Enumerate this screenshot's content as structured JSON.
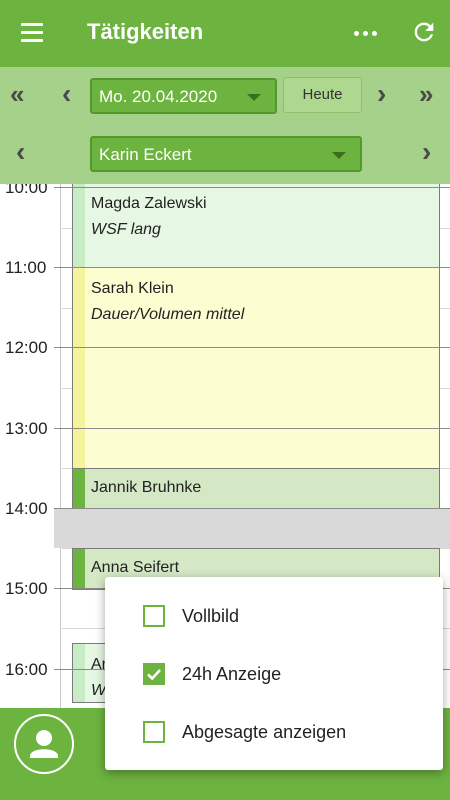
{
  "header": {
    "title": "Tätigkeiten",
    "icons": {
      "menu": "hamburger-menu-icon",
      "more": "more-dots-icon",
      "refresh": "refresh-icon"
    }
  },
  "date_nav": {
    "prev_week": "«",
    "prev_day": "‹",
    "date_value": "Mo. 20.04.2020",
    "today_label": "Heute",
    "next_day": "›",
    "next_week": "»"
  },
  "employee_nav": {
    "prev": "‹",
    "employee_value": "Karin Eckert",
    "next": "›"
  },
  "timeline": {
    "hours": [
      "10:00",
      "11:00",
      "12:00",
      "13:00",
      "14:00",
      "15:00",
      "16:00"
    ],
    "events": [
      {
        "name": "Magda Zalewski",
        "subtitle": "WSF lang",
        "color": "#e6f7e3",
        "stripe": "#c8ecc6"
      },
      {
        "name": "Sarah Klein",
        "subtitle": "Dauer/Volumen mittel",
        "color": "#fdfdd2",
        "stripe": "#f4f49c"
      },
      {
        "name": "Jannik Bruhnke",
        "subtitle": "",
        "color": "#d4e8c6",
        "stripe": "#6db33f"
      },
      {
        "name": "Anna Seifert",
        "subtitle": "",
        "color": "#d4e8c6",
        "stripe": "#6db33f"
      },
      {
        "name": "An",
        "subtitle": "W",
        "color": "#e6f7e3",
        "stripe": "#c8ecc6"
      }
    ]
  },
  "options_menu": {
    "items": [
      {
        "label": "Vollbild",
        "checked": false
      },
      {
        "label": "24h Anzeige",
        "checked": true
      },
      {
        "label": "Abgesagte anzeigen",
        "checked": false
      }
    ]
  },
  "bottom_bar": {
    "icons": {
      "profile": "person-icon"
    }
  },
  "colors": {
    "primary": "#6db33f",
    "light": "#a5d18a"
  }
}
